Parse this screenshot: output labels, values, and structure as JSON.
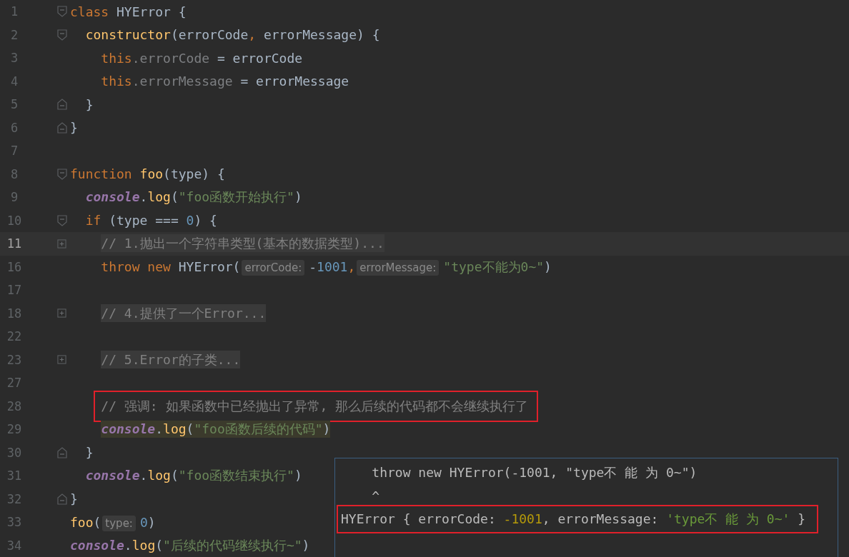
{
  "editor": {
    "lines": [
      {
        "number": "1",
        "fold": {
          "kind": "start"
        },
        "tokens": [
          {
            "kind": "kw",
            "text": "class "
          },
          {
            "kind": "plain",
            "text": "HYError {"
          }
        ]
      },
      {
        "number": "2",
        "fold": {
          "kind": "start"
        },
        "tokens": [
          {
            "kind": "fn",
            "text": "  constructor"
          },
          {
            "kind": "plain",
            "text": "(errorCode"
          },
          {
            "kind": "kw",
            "text": ","
          },
          {
            "kind": "plain",
            "text": " errorMessage) {"
          }
        ]
      },
      {
        "number": "3",
        "tokens": [
          {
            "kind": "kw",
            "text": "    this"
          },
          {
            "kind": "field",
            "text": ".errorCode"
          },
          {
            "kind": "plain",
            "text": " = errorCode"
          }
        ]
      },
      {
        "number": "4",
        "tokens": [
          {
            "kind": "kw",
            "text": "    this"
          },
          {
            "kind": "field",
            "text": ".errorMessage"
          },
          {
            "kind": "plain",
            "text": " = errorMessage"
          }
        ]
      },
      {
        "number": "5",
        "fold": {
          "kind": "end"
        },
        "tokens": [
          {
            "kind": "plain",
            "text": "  }"
          }
        ]
      },
      {
        "number": "6",
        "fold": {
          "kind": "end"
        },
        "tokens": [
          {
            "kind": "plain",
            "text": "}"
          }
        ]
      },
      {
        "number": "7"
      },
      {
        "number": "8",
        "fold": {
          "kind": "start"
        },
        "tokens": [
          {
            "kind": "kw",
            "text": "function "
          },
          {
            "kind": "fn",
            "text": "foo"
          },
          {
            "kind": "plain",
            "text": "(type) {"
          }
        ]
      },
      {
        "number": "9",
        "tokens": [
          {
            "kind": "obj",
            "text": "  console"
          },
          {
            "kind": "plain",
            "text": "."
          },
          {
            "kind": "fn",
            "text": "log"
          },
          {
            "kind": "plain",
            "text": "("
          },
          {
            "kind": "str",
            "text": "\"foo函数开始执行\""
          },
          {
            "kind": "plain",
            "text": ")"
          }
        ]
      },
      {
        "number": "10",
        "fold": {
          "kind": "start"
        },
        "tokens": [
          {
            "kind": "kw",
            "text": "  if "
          },
          {
            "kind": "plain",
            "text": "(type === "
          },
          {
            "kind": "num",
            "text": "0"
          },
          {
            "kind": "plain",
            "text": ") {"
          }
        ]
      },
      {
        "number": "11",
        "indent": {
          "kind": "level2"
        },
        "fold": {
          "kind": "collapsed"
        },
        "current": true,
        "tokens": [
          {
            "kind": "folded",
            "text": "// 1.抛出一个字符串类型(基本的数据类型)..."
          }
        ]
      },
      {
        "number": "16",
        "tokens": [
          {
            "kind": "kw",
            "text": "    throw new "
          },
          {
            "kind": "plain",
            "text": "HYError("
          },
          {
            "kind": "hint",
            "text": "errorCode:"
          },
          {
            "kind": "plain",
            "text": "-"
          },
          {
            "kind": "num",
            "text": "1001"
          },
          {
            "kind": "kw",
            "text": ","
          },
          {
            "kind": "hint",
            "text": "errorMessage:"
          },
          {
            "kind": "str",
            "text": "\"type不能为0~\""
          },
          {
            "kind": "plain",
            "text": ")"
          }
        ]
      },
      {
        "number": "17"
      },
      {
        "number": "18",
        "indent": {
          "kind": "level2"
        },
        "fold": {
          "kind": "collapsed"
        },
        "tokens": [
          {
            "kind": "folded",
            "text": "// 4.提供了一个Error..."
          }
        ]
      },
      {
        "number": "22"
      },
      {
        "number": "23",
        "indent": {
          "kind": "level2"
        },
        "fold": {
          "kind": "collapsed"
        },
        "tokens": [
          {
            "kind": "folded",
            "text": "// 5.Error的子类..."
          }
        ]
      },
      {
        "number": "27"
      },
      {
        "number": "28",
        "indent": {
          "kind": "level2"
        },
        "annotated": true,
        "tokens": [
          {
            "kind": "cmt",
            "text": "// 强调: 如果函数中已经抛出了异常, 那么后续的代码都不会继续执行了"
          }
        ]
      },
      {
        "number": "29",
        "indent": {
          "kind": "level2"
        },
        "highlighted": true,
        "tokens": [
          {
            "kind": "obj",
            "text": "console"
          },
          {
            "kind": "plain",
            "text": "."
          },
          {
            "kind": "fn",
            "text": "log"
          },
          {
            "kind": "plain",
            "text": "("
          },
          {
            "kind": "str",
            "text": "\"foo函数后续的代码\""
          },
          {
            "kind": "plain",
            "text": ")"
          }
        ]
      },
      {
        "number": "30",
        "fold": {
          "kind": "end"
        },
        "tokens": [
          {
            "kind": "plain",
            "text": "  }"
          }
        ]
      },
      {
        "number": "31",
        "tokens": [
          {
            "kind": "obj",
            "text": "  console"
          },
          {
            "kind": "plain",
            "text": "."
          },
          {
            "kind": "fn",
            "text": "log"
          },
          {
            "kind": "plain",
            "text": "("
          },
          {
            "kind": "str",
            "text": "\"foo函数结束执行\""
          },
          {
            "kind": "plain",
            "text": ")"
          }
        ]
      },
      {
        "number": "32",
        "fold": {
          "kind": "end"
        },
        "tokens": [
          {
            "kind": "plain",
            "text": "}"
          }
        ]
      },
      {
        "number": "33",
        "tokens": [
          {
            "kind": "fn",
            "text": "foo"
          },
          {
            "kind": "plain",
            "text": "("
          },
          {
            "kind": "hint",
            "text": "type:"
          },
          {
            "kind": "num",
            "text": "0"
          },
          {
            "kind": "plain",
            "text": ")"
          }
        ]
      },
      {
        "number": "34",
        "tokens": [
          {
            "kind": "obj",
            "text": "console"
          },
          {
            "kind": "plain",
            "text": "."
          },
          {
            "kind": "fn",
            "text": "log"
          },
          {
            "kind": "plain",
            "text": "("
          },
          {
            "kind": "str",
            "text": "\"后续的代码继续执行~\""
          },
          {
            "kind": "plain",
            "text": ")"
          }
        ]
      }
    ]
  },
  "console_output": {
    "lines": [
      {
        "tokens": [
          {
            "kind": "plain",
            "text": "    throw new HYError(-1001, \"type不 能 为 0~\")"
          }
        ]
      },
      {
        "tokens": [
          {
            "kind": "plain",
            "text": "    ^"
          }
        ]
      },
      {
        "annotated": true,
        "tokens": [
          {
            "kind": "plain",
            "text": "HYError { errorCode: "
          },
          {
            "kind": "num",
            "text": "-1001"
          },
          {
            "kind": "plain",
            "text": ", errorMessage: "
          },
          {
            "kind": "str",
            "text": "'type不 能 为 0~'"
          },
          {
            "kind": "plain",
            "text": " }"
          }
        ]
      }
    ]
  }
}
